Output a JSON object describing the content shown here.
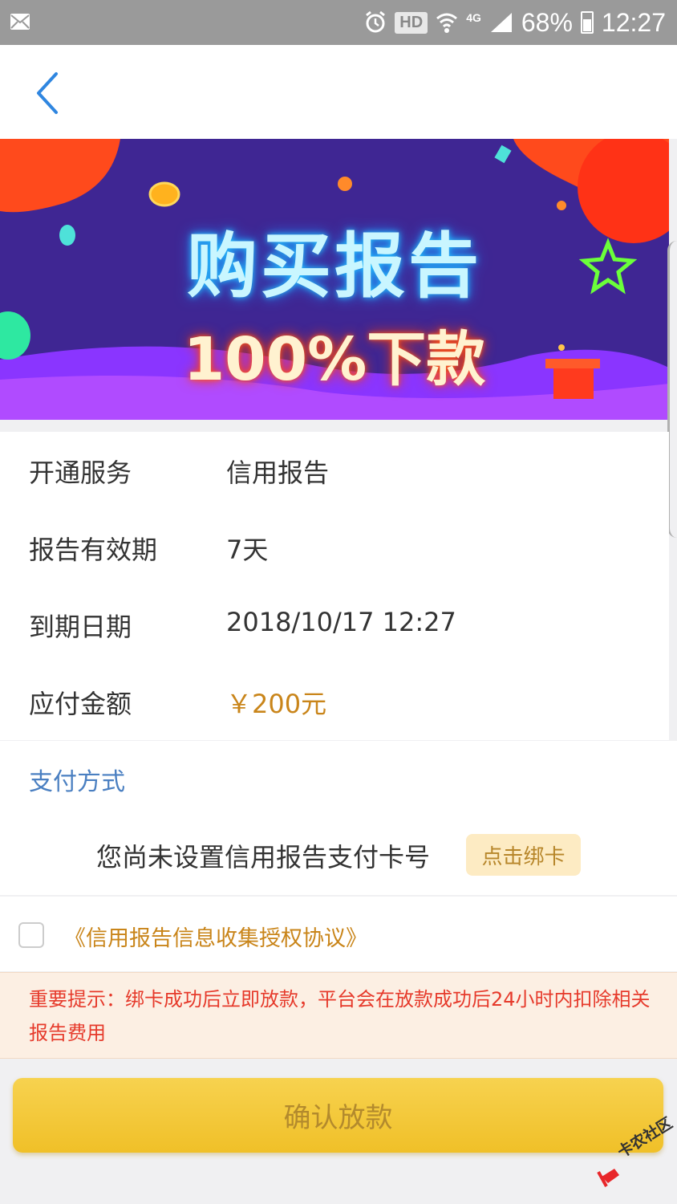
{
  "status_bar": {
    "hd_label": "HD",
    "network_label": "4G",
    "battery_percent": "68%",
    "battery_level": 0.68,
    "time": "12:27",
    "icons": [
      "mail-icon",
      "alarm-icon",
      "wifi-icon",
      "signal-icon",
      "battery-icon"
    ]
  },
  "nav": {
    "back_icon": "chevron-left-icon"
  },
  "banner": {
    "title": "购买报告",
    "subtitle": "100%下款",
    "colors": {
      "background": "#3f2693",
      "accent_orange": "#ff4a1c",
      "neon_blue": "#c9f6ff"
    }
  },
  "info": {
    "rows": [
      {
        "label": "开通服务",
        "value": "信用报告"
      },
      {
        "label": "报告有效期",
        "value": "7天"
      },
      {
        "label": "到期日期",
        "value": "2018/10/17 12:27"
      },
      {
        "label": "应付金额",
        "value": "￥200元"
      }
    ]
  },
  "payment": {
    "title": "支付方式",
    "no_card_text": "您尚未设置信用报告支付卡号",
    "bind_button": "点击绑卡"
  },
  "agreement": {
    "checked": false,
    "link_text": "《信用报告信息收集授权协议》"
  },
  "notice": {
    "text": "重要提示：绑卡成功后立即放款，平台会在放款成功后24小时内扣除相关报告费用"
  },
  "confirm_button": "确认放款",
  "watermark": {
    "text": "卡农社区"
  },
  "colors": {
    "accent_gold": "#c9851a",
    "link_blue": "#4a7fc1",
    "notice_red": "#e63a2b",
    "button_yellow": "#f0c028",
    "status_bar_gray": "#9a9a9a"
  }
}
